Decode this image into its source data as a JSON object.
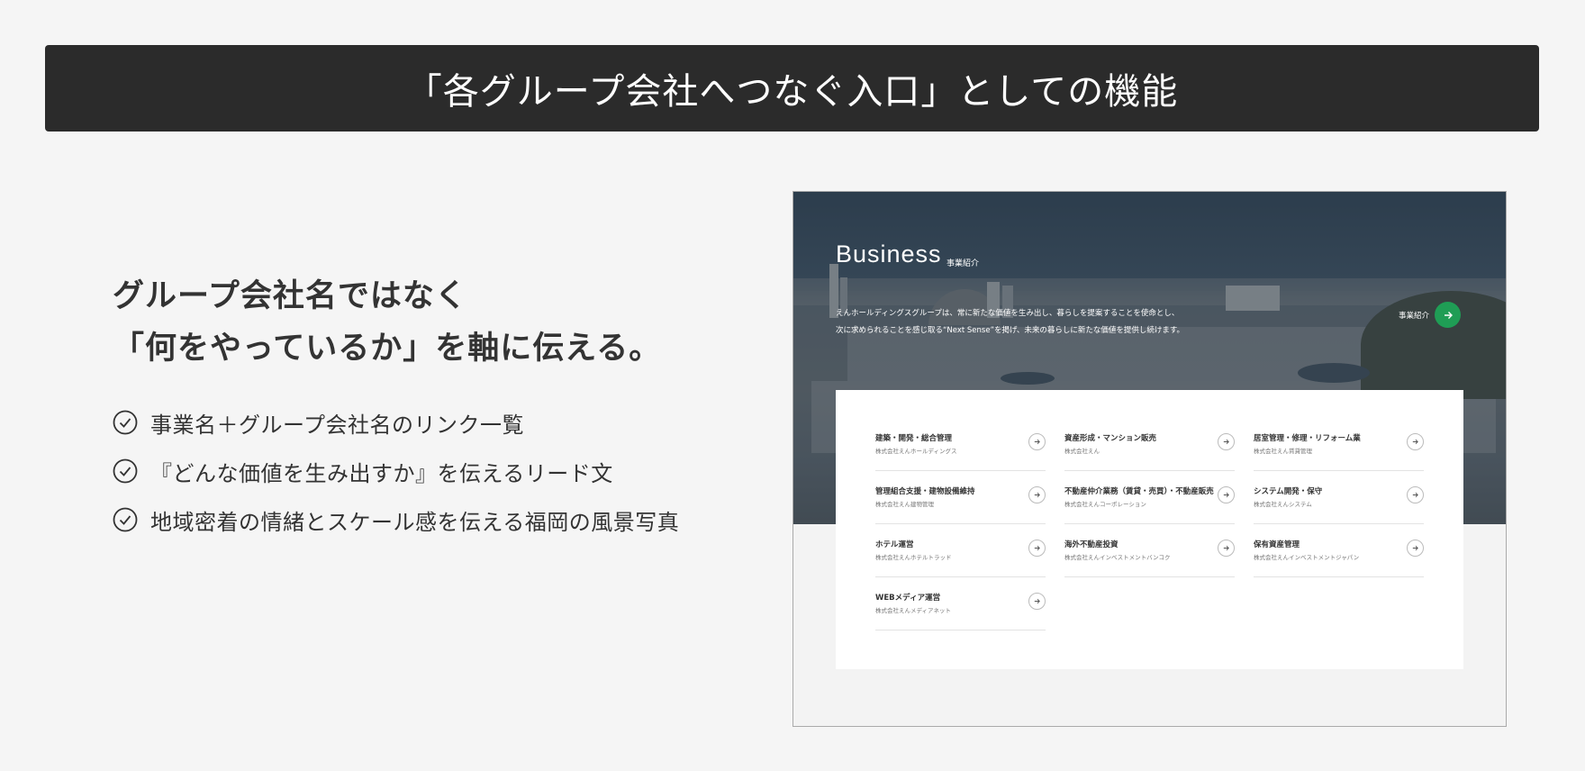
{
  "header": {
    "title": "「各グループ会社へつなぐ入口」としての機能"
  },
  "headline": {
    "line1": "グループ会社名ではなく",
    "line2": "「何をやっているか」を軸に伝える。"
  },
  "points": [
    {
      "label": "事業名＋グループ会社名のリンク一覧"
    },
    {
      "label": "『どんな価値を生み出すか』を伝えるリード文"
    },
    {
      "label": "地域密着の情緒とスケール感を伝える福岡の風景写真"
    }
  ],
  "preview": {
    "title": "Business",
    "subtitle": "事業紹介",
    "lead_line1": "えんホールディングスグループは、常に新たな価値を生み出し、暮らしを提案することを使命とし、",
    "lead_line2": "次に求められることを感じ取る“Next Sense”を掲げ、未来の暮らしに新たな価値を提供し続けます。",
    "more_label": "事業紹介",
    "accent_color": "#1f9d55",
    "items": [
      {
        "name": "建築・開発・総合管理",
        "company": "株式会社えんホールディングス"
      },
      {
        "name": "資産形成・マンション販売",
        "company": "株式会社えん"
      },
      {
        "name": "居室管理・修理・リフォーム業",
        "company": "株式会社えん賃貸管理"
      },
      {
        "name": "管理組合支援・建物設備維持",
        "company": "株式会社えん建物管理"
      },
      {
        "name": "不動産仲介業務（賃貸・売買）・不動産販売",
        "company": "株式会社えんコーポレーション"
      },
      {
        "name": "システム開発・保守",
        "company": "株式会社えんシステム"
      },
      {
        "name": "ホテル運営",
        "company": "株式会社えんホテルトラッド"
      },
      {
        "name": "海外不動産投資",
        "company": "株式会社えんインベストメントバンコク"
      },
      {
        "name": "保有資産管理",
        "company": "株式会社えんインベストメントジャパン"
      },
      {
        "name": "WEBメディア運営",
        "company": "株式会社えんメディアネット"
      }
    ]
  }
}
